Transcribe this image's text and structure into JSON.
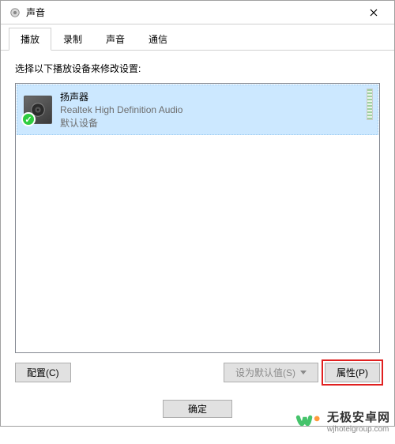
{
  "window": {
    "title": "声音"
  },
  "tabs": [
    {
      "label": "播放",
      "active": true
    },
    {
      "label": "录制",
      "active": false
    },
    {
      "label": "声音",
      "active": false
    },
    {
      "label": "通信",
      "active": false
    }
  ],
  "instruction": "选择以下播放设备来修改设置:",
  "devices": [
    {
      "name": "扬声器",
      "driver": "Realtek High Definition Audio",
      "status": "默认设备",
      "selected": true,
      "default": true
    }
  ],
  "buttons": {
    "configure": "配置(C)",
    "set_default": "设为默认值(S)",
    "properties": "属性(P)"
  },
  "footer": {
    "ok": "确定"
  },
  "watermark": {
    "cn": "无极安卓网",
    "url": "wjhotelgroup.com"
  }
}
